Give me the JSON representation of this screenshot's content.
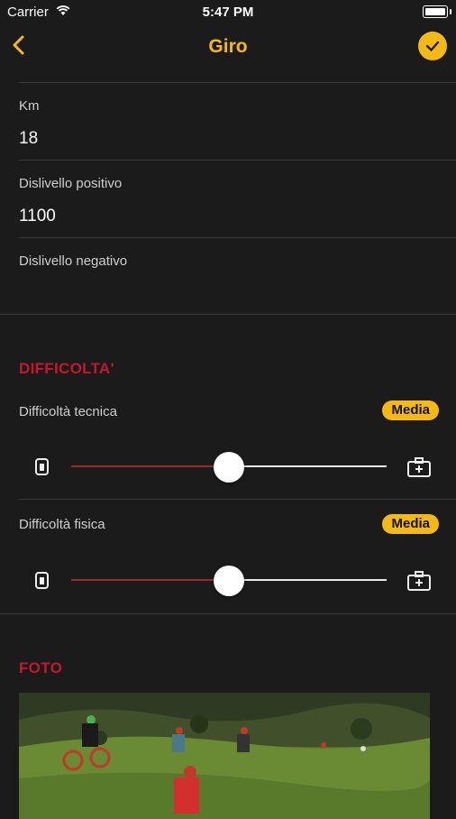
{
  "status_bar": {
    "carrier": "Carrier",
    "time": "5:47 PM"
  },
  "nav": {
    "title": "Giro",
    "back_icon": "chevron-left-icon",
    "confirm_icon": "check-icon"
  },
  "fields": [
    {
      "label": "Km",
      "value": "18"
    },
    {
      "label": "Dislivello positivo",
      "value": "1100"
    },
    {
      "label": "Dislivello negativo",
      "value": ""
    }
  ],
  "difficulty": {
    "section_title": "DIFFICOLTA'",
    "technical": {
      "label": "Difficoltà tecnica",
      "badge": "Media",
      "level": 0.5
    },
    "physical": {
      "label": "Difficoltà fisica",
      "badge": "Media",
      "level": 0.5
    }
  },
  "photos": {
    "section_title": "FOTO"
  },
  "colors": {
    "accent": "#f5b914",
    "section": "#c4192c",
    "background": "#1b1b1b"
  }
}
